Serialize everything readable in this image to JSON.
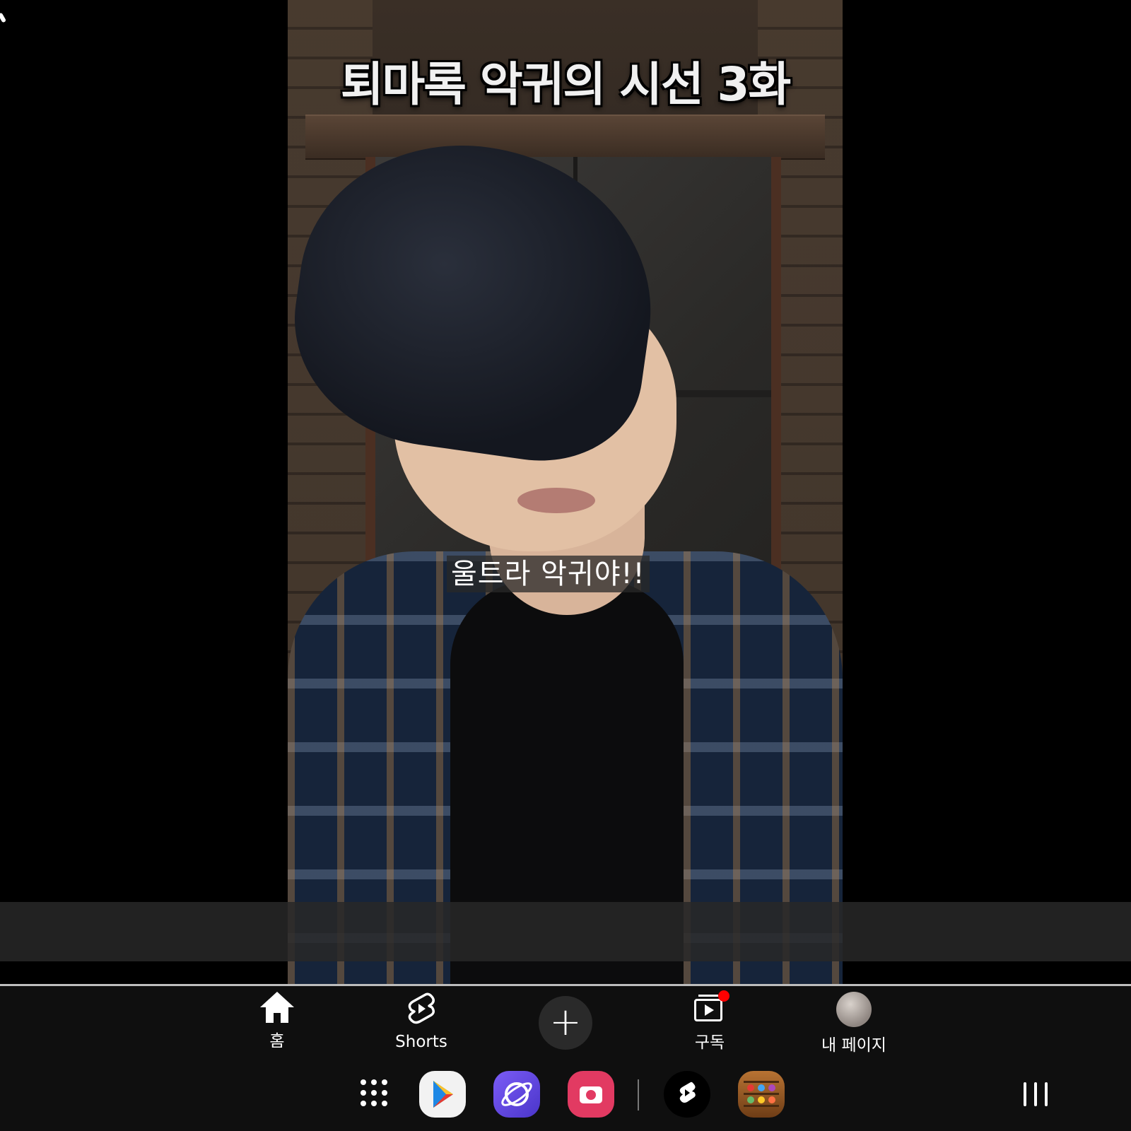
{
  "video": {
    "title_overlay": "퇴마록 악귀의 시선 3화",
    "caption": "울트라 악귀야!!"
  },
  "bottom_nav": {
    "items": [
      {
        "label": "홈",
        "icon": "home-icon"
      },
      {
        "label": "Shorts",
        "icon": "shorts-icon"
      },
      {
        "label": "",
        "icon": "create-plus-icon"
      },
      {
        "label": "구독",
        "icon": "subscriptions-icon",
        "has_notification_dot": true
      },
      {
        "label": "내 페이지",
        "icon": "avatar-icon"
      }
    ]
  },
  "taskbar": {
    "apps": [
      {
        "name": "app-drawer",
        "icon": "grid-icon"
      },
      {
        "name": "Play Store",
        "icon": "play-store-icon",
        "color": "#ffffff"
      },
      {
        "name": "Samsung Internet",
        "icon": "internet-browser-icon",
        "color": "#6a4cf0"
      },
      {
        "name": "Camera",
        "icon": "camera-icon",
        "color": "#e23a62"
      },
      {
        "name": "YouTube Shorts",
        "icon": "shorts-app-icon",
        "color": "#000000"
      },
      {
        "name": "Game",
        "icon": "game-app-icon",
        "color": "#a0602a"
      }
    ],
    "recents_icon": "recents-icon"
  },
  "colors": {
    "notification_dot": "#ff0000",
    "nav_background": "#0f0f0f"
  }
}
